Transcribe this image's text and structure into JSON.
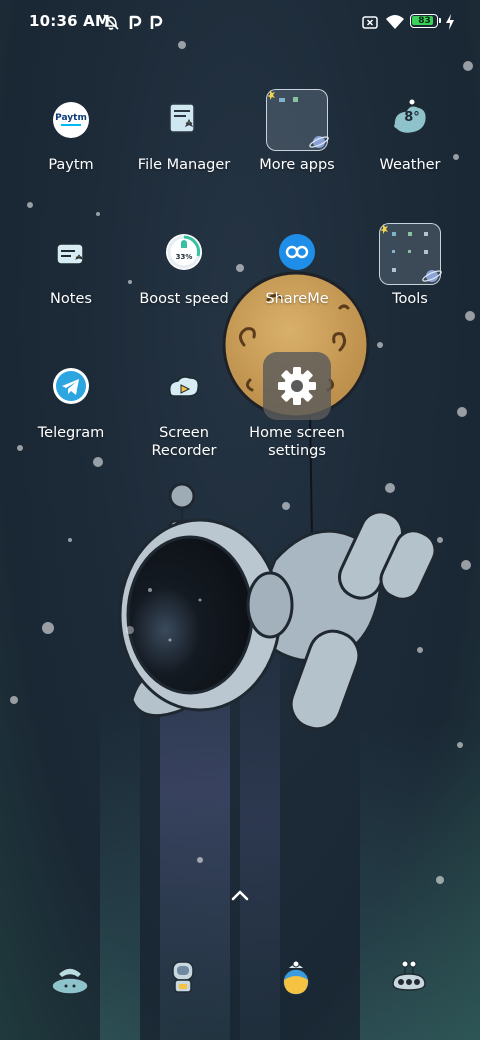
{
  "status_bar": {
    "time": "10:36 AM",
    "battery_level": "83",
    "battery_fraction": 0.83,
    "left_icons": [
      "alarm-off-icon",
      "paytm-p-icon",
      "paytm-p-icon"
    ],
    "right_icons": [
      "no-sim-icon",
      "wifi-icon",
      "battery-icon",
      "charging-icon"
    ]
  },
  "home": {
    "apps": [
      {
        "label": "Paytm",
        "icon": "paytm-icon"
      },
      {
        "label": "File Manager",
        "icon": "file-manager-icon"
      },
      {
        "label": "More apps",
        "icon": "folder-icon"
      },
      {
        "label": "Weather",
        "icon": "weather-icon"
      },
      {
        "label": "Notes",
        "icon": "notes-icon"
      },
      {
        "label": "Boost speed",
        "icon": "boost-speed-icon",
        "badge": "33%"
      },
      {
        "label": "ShareMe",
        "icon": "shareme-icon"
      },
      {
        "label": "Tools",
        "icon": "folder-icon"
      },
      {
        "label": "Telegram",
        "icon": "telegram-icon"
      },
      {
        "label": "Screen Recorder",
        "icon": "screen-recorder-icon"
      },
      {
        "label": "Home screen settings",
        "icon": "gear-icon"
      }
    ],
    "weather_temp": "8°"
  },
  "app_drawer_hint": "chevron-up-icon",
  "dock": [
    "phone-icon",
    "messaging-icon",
    "browser-icon",
    "camera-icon"
  ],
  "colors": {
    "accent_paytm": "#00baf2",
    "telegram": "#2ca5e0",
    "shareme": "#1e8ee8",
    "battery_green": "#3ad35a"
  }
}
